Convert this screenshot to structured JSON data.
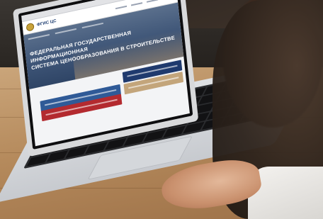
{
  "scene": {
    "screen": {
      "logo_text": "ФГИС ЦС",
      "hero_title_line1": "ФЕДЕРАЛЬНАЯ ГОСУДАРСТВЕННАЯ ИНФОРМАЦИОННАЯ",
      "hero_title_line2": "СИСТЕМА ЦЕНООБРАЗОВАНИЯ В СТРОИТЕЛЬСТВЕ"
    },
    "colors": {
      "navy": "#1f3a6e",
      "red": "#b32a2f",
      "tan": "#c3a57b",
      "wood": "#b58a5c"
    }
  }
}
